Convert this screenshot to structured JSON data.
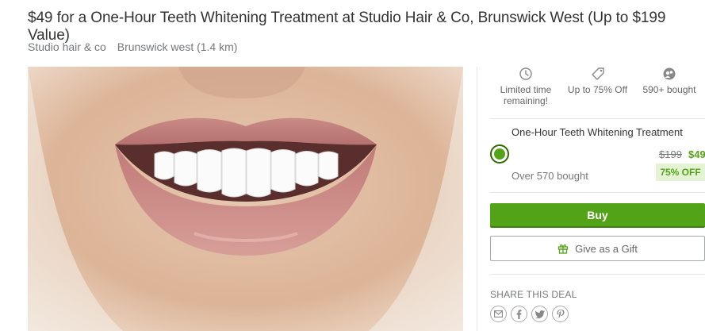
{
  "deal": {
    "title": "$49 for a One-Hour Teeth Whitening Treatment at Studio Hair & Co, Brunswick West (Up to $199 Value)",
    "merchant": "Studio hair & co",
    "location": "Brunswick west (1.4 km)"
  },
  "features": [
    {
      "icon": "clock-icon",
      "text": "Limited time remaining!"
    },
    {
      "icon": "tag-icon",
      "text": "Up to 75% Off"
    },
    {
      "icon": "bought-icon",
      "text": "590+ bought"
    }
  ],
  "option": {
    "title": "One-Hour Teeth Whitening Treatment",
    "original_price": "$199",
    "price": "$49",
    "bought": "Over 570 bought",
    "discount": "75% OFF"
  },
  "actions": {
    "buy_label": "Buy",
    "gift_label": "Give as a Gift"
  },
  "share": {
    "title": "SHARE THIS DEAL",
    "items": [
      "email-icon",
      "facebook-icon",
      "twitter-icon",
      "pinterest-icon"
    ]
  },
  "colors": {
    "accent": "#53a318",
    "discount_bg": "#e4f3d4"
  }
}
